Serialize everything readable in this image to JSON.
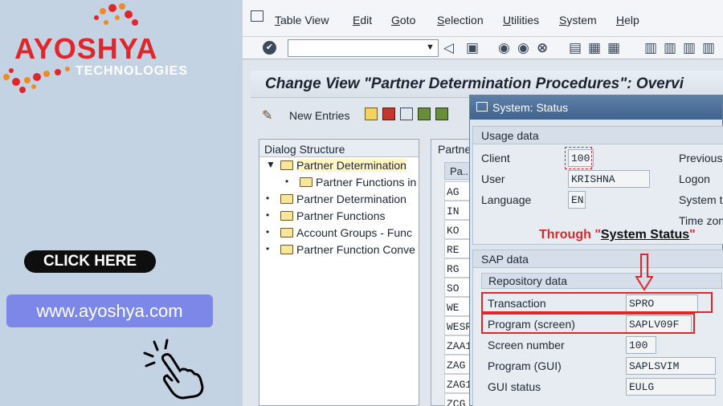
{
  "promo": {
    "brand": "AYOSHYA",
    "brand_sub": "TECHNOLOGIES",
    "cta": "CLICK HERE",
    "url": "www.ayoshya.com",
    "colors": {
      "brand_red": "#e0262a",
      "url_box": "#7d87e8",
      "cta_bg": "#0e0e0e"
    },
    "icons": [
      "pointing-hand-icon"
    ]
  },
  "menu": {
    "items": [
      "Table View",
      "Edit",
      "Goto",
      "Selection",
      "Utilities",
      "System",
      "Help"
    ]
  },
  "toolbar": {
    "command_value": ""
  },
  "window": {
    "title": "Change View \"Partner Determination Procedures\": Overvi",
    "new_entries": "New Entries"
  },
  "tree": {
    "header": "Dialog Structure",
    "items": [
      {
        "label": "Partner Determination"
      },
      {
        "label": "Partner Functions in"
      },
      {
        "label": "Partner Determination"
      },
      {
        "label": "Partner Functions"
      },
      {
        "label": "Account Groups - Func"
      },
      {
        "label": "Partner Function Conve"
      }
    ]
  },
  "table": {
    "header": "Partne",
    "column": "Pa..",
    "rows": [
      "AG",
      "IN",
      "KO",
      "RE",
      "RG",
      "SO",
      "WE",
      "WESR",
      "ZAA1",
      "ZAG",
      "ZAG1",
      "ZCG"
    ]
  },
  "dialog": {
    "title": "System: Status",
    "usage": {
      "header": "Usage data",
      "client_label": "Client",
      "client_value": "100",
      "user_label": "User",
      "user_value": "KRISHNA",
      "language_label": "Language",
      "language_value": "EN",
      "previous_label": "Previous",
      "logon_label": "Logon",
      "systemt_label": "System t",
      "timezone_label": "Time zon"
    },
    "note_prefix": "Through \"",
    "note_highlight": "System Status",
    "note_suffix": "\"",
    "sap": {
      "header": "SAP data",
      "repo_header": "Repository data",
      "transaction_label": "Transaction",
      "transaction_value": "SPRO",
      "program_screen_label": "Program (screen)",
      "program_screen_value": "SAPLV09F",
      "screen_number_label": "Screen number",
      "screen_number_value": "100",
      "program_gui_label": "Program (GUI)",
      "program_gui_value": "SAPLSVIM",
      "gui_status_label": "GUI status",
      "gui_status_value": "EULG"
    }
  }
}
